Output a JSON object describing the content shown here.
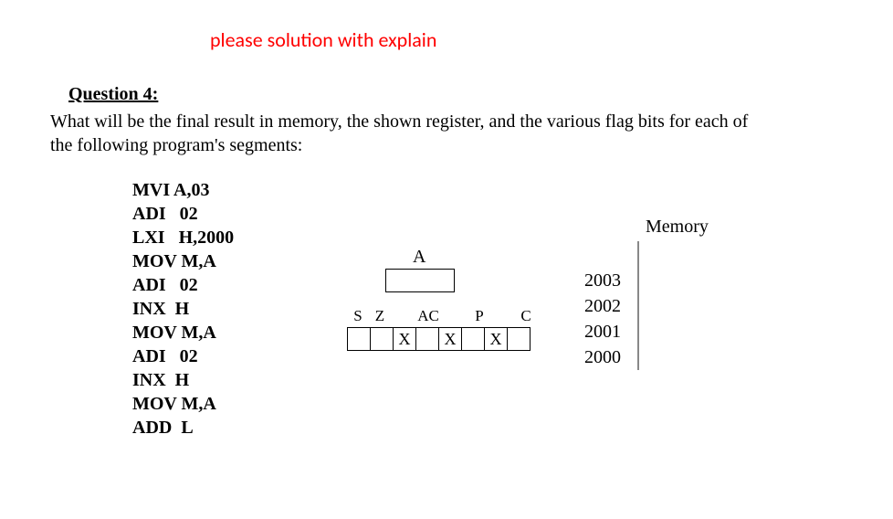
{
  "note": "please solution with explain",
  "question_header": "Question 4:",
  "question_text": "What will be the final result in memory, the shown register, and the various flag bits for each of the following program's segments:",
  "program": [
    "MVI A,03",
    "ADI   02",
    "LXI   H,2000",
    "MOV M,A",
    "ADI   02",
    "INX  H",
    "MOV M,A",
    "ADI   02",
    "INX  H",
    "MOV M,A",
    "ADD  L"
  ],
  "register": {
    "a_label": "A",
    "a_value": ""
  },
  "flags": {
    "labels": [
      "S",
      "Z",
      "",
      "AC",
      "",
      "P",
      "",
      "C"
    ],
    "values": [
      "",
      "",
      "X",
      "",
      "X",
      "",
      "X",
      ""
    ]
  },
  "memory": {
    "label": "Memory",
    "addrs": [
      "2003",
      "2002",
      "2001",
      "2000"
    ],
    "cells": [
      "",
      "",
      "",
      "",
      ""
    ]
  }
}
